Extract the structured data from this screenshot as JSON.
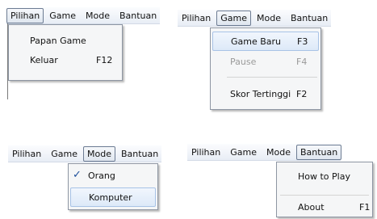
{
  "panel1": {
    "menubar": [
      "Pilihan",
      "Game",
      "Mode",
      "Bantuan"
    ],
    "active": "Pilihan",
    "items": [
      {
        "label": "Papan Game",
        "shortcut": ""
      },
      {
        "label": "Keluar",
        "shortcut": "F12"
      }
    ]
  },
  "panel2": {
    "menubar": [
      "Pilihan",
      "Game",
      "Mode",
      "Bantuan"
    ],
    "active": "Game",
    "items": [
      {
        "label": "Game Baru",
        "shortcut": "F3",
        "state": "highlighted"
      },
      {
        "label": "Pause",
        "shortcut": "F4",
        "state": "disabled"
      },
      {
        "label": "Skor Tertinggi",
        "shortcut": "F2",
        "state": "normal"
      }
    ]
  },
  "panel3": {
    "menubar": [
      "Pilihan",
      "Game",
      "Mode",
      "Bantuan"
    ],
    "active": "Mode",
    "items": [
      {
        "label": "Orang",
        "checked": true,
        "icon": "check-icon"
      },
      {
        "label": "Komputer",
        "state": "highlighted"
      }
    ]
  },
  "panel4": {
    "menubar": [
      "Pilihan",
      "Game",
      "Mode",
      "Bantuan"
    ],
    "active": "Bantuan",
    "items": [
      {
        "label": "How to Play",
        "shortcut": ""
      },
      {
        "label": "About",
        "shortcut": "F1"
      }
    ]
  },
  "colors": {
    "highlight_fill": "#dde9f8",
    "highlight_border": "#a8c3e6",
    "disabled_text": "#9a9a9a",
    "check_mark": "#1c4e9a"
  }
}
